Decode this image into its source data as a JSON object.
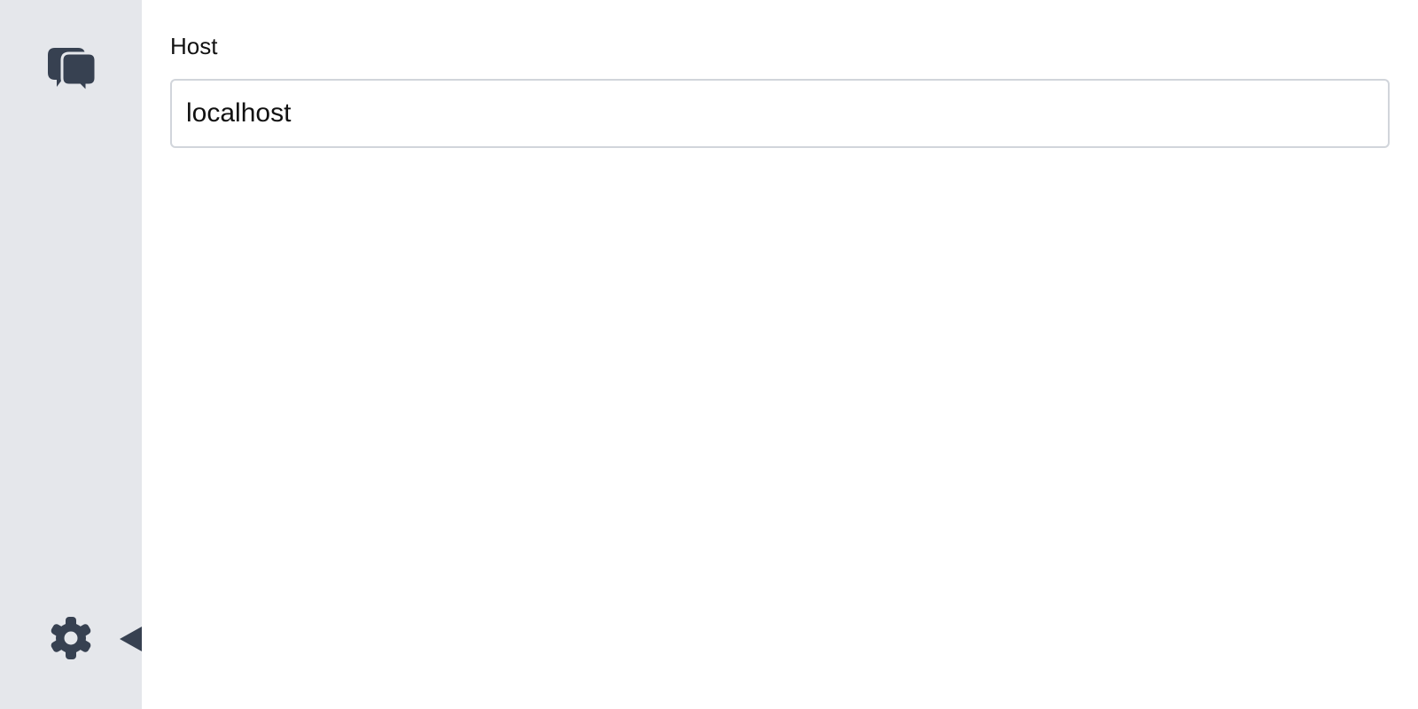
{
  "sidebar": {
    "items": [
      {
        "icon": "chat-bubbles-icon",
        "label": ""
      },
      {
        "icon": "gear-icon",
        "label": ""
      }
    ],
    "active_item": "settings"
  },
  "settings": {
    "host_label": "Host",
    "host_value": "localhost"
  },
  "colors": {
    "sidebar_bg": "#e5e7eb",
    "icon": "#374151",
    "input_border": "#d1d5db"
  }
}
